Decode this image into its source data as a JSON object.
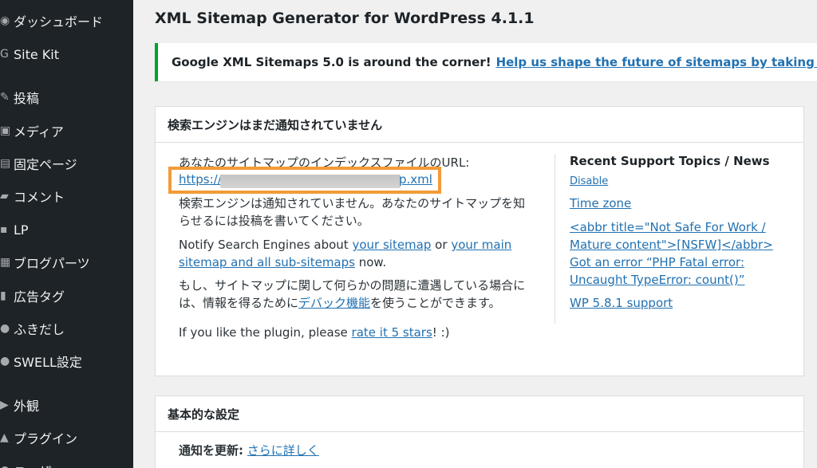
{
  "sidebar": {
    "items": [
      {
        "label": "ダッシュボード",
        "icon": "dashboard-icon"
      },
      {
        "label": "Site Kit",
        "icon": "sitekit-icon"
      },
      {
        "label": "投稿",
        "icon": "pin-icon"
      },
      {
        "label": "メディア",
        "icon": "media-icon"
      },
      {
        "label": "固定ページ",
        "icon": "page-icon"
      },
      {
        "label": "コメント",
        "icon": "comment-icon"
      },
      {
        "label": "LP",
        "icon": "lp-icon"
      },
      {
        "label": "ブログパーツ",
        "icon": "blog-parts-icon"
      },
      {
        "label": "広告タグ",
        "icon": "ad-tag-icon"
      },
      {
        "label": "ふきだし",
        "icon": "speech-bubble-icon"
      },
      {
        "label": "SWELL設定",
        "icon": "swell-icon"
      },
      {
        "label": "外観",
        "icon": "appearance-icon"
      },
      {
        "label": "プラグイン",
        "icon": "plugin-icon"
      },
      {
        "label": "ユーザー",
        "icon": "users-icon"
      }
    ]
  },
  "page": {
    "title": "XML Sitemap Generator for WordPress 4.1.1"
  },
  "notice": {
    "text": "Google XML Sitemaps 5.0 is around the corner!",
    "link": "Help us shape the future of sitemaps by taking this short s"
  },
  "status_box": {
    "title": "検索エンジンはまだ通知されていません",
    "url_label": "あなたのサイトマップのインデックスファイルのURL:",
    "url_start": "https://",
    "url_end": "p.xml",
    "not_notified_1": "検索エンジンは通知されていません。あなたのサイトマップを知",
    "not_notified_2": "らせるには投稿を書いてください。",
    "notify_prefix": "Notify Search Engines about",
    "notify_link1": "your sitemap",
    "notify_or": "or",
    "notify_link2a": "your main",
    "notify_link2b": "sitemap and all sub-sitemaps",
    "notify_now": "now.",
    "problem_1": "もし、サイトマップに関して何らかの問題に遭遇している場合に",
    "problem_2a": "は、情報を得るために",
    "problem_link": "デバック機能",
    "problem_2b": "を使うことができます。",
    "rate_prefix": "If you like the plugin, please",
    "rate_link": "rate it 5 stars",
    "rate_suffix": "! :)"
  },
  "support": {
    "title": "Recent Support Topics / News",
    "disable": "Disable",
    "topics": [
      "Time zone",
      "<abbr title=\"Not Safe For Work /",
      "Mature content\">[NSFW]</abbr>",
      "Got an error “PHP Fatal error:",
      "Uncaught TypeError: count()”",
      "WP 5.8.1 support"
    ]
  },
  "basic_box": {
    "title": "基本的な設定",
    "update_label": "通知を更新:",
    "update_link": "さらに詳しく"
  },
  "colors": {
    "sidebar_bg": "#1d2327",
    "link": "#2271b1",
    "notice_border": "#00a32a",
    "highlight": "#f29b37"
  }
}
